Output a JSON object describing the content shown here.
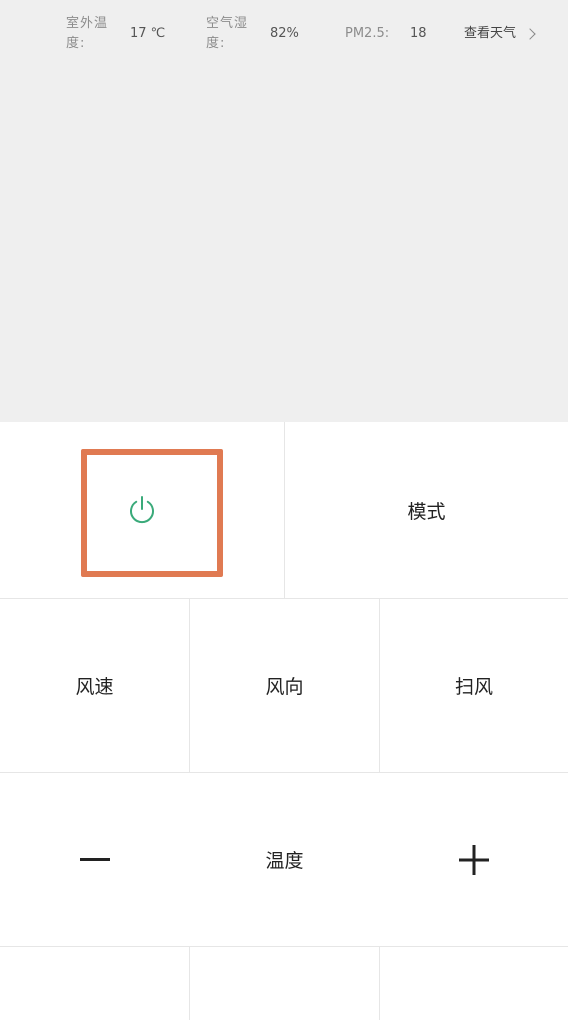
{
  "weather": {
    "outdoor_temp_label": "室外温度:",
    "outdoor_temp_value": "17 ℃",
    "humidity_label": "空气湿度:",
    "humidity_value": "82%",
    "pm25_label": "PM2.5:",
    "pm25_value": "18",
    "view_weather_label": "查看天气"
  },
  "controls": {
    "power_icon": "power-icon",
    "power_color": "#3aaa7a",
    "highlight_color": "#e07a52",
    "mode_label": "模式",
    "fan_speed_label": "风速",
    "fan_direction_label": "风向",
    "swing_label": "扫风",
    "temperature_label": "温度",
    "decrease_label": "—",
    "increase_label": "+"
  }
}
